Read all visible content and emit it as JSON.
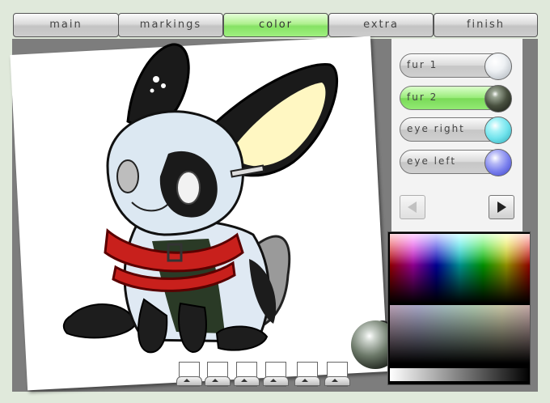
{
  "tabs": [
    {
      "label": "main",
      "active": false
    },
    {
      "label": "markings",
      "active": false
    },
    {
      "label": "color",
      "active": true
    },
    {
      "label": "extra",
      "active": false
    },
    {
      "label": "finish",
      "active": false
    }
  ],
  "color_slots": [
    {
      "label": "fur 1",
      "swatch": "#eef1f4",
      "active": false
    },
    {
      "label": "fur 2",
      "swatch": "#48503f",
      "active": true
    },
    {
      "label": "eye right",
      "swatch": "#6fe2ec",
      "active": false
    },
    {
      "label": "eye left",
      "swatch": "#7c82ee",
      "active": false
    }
  ],
  "nav": {
    "prev_icon": "triangle-left-icon",
    "next_icon": "triangle-right-icon"
  },
  "page_tabs_count": 6,
  "colors": {
    "accent_green": "#8fe86f",
    "background": "#e0e9db",
    "stage": "#7d7d7d",
    "collar_red": "#c8201c",
    "ear_inner": "#fff7c2"
  }
}
